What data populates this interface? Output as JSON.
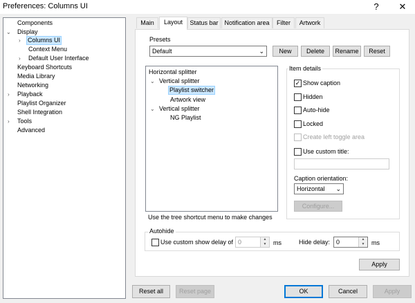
{
  "window": {
    "title": "Preferences: Columns UI",
    "help_glyph": "?",
    "close_glyph": "✕"
  },
  "tree": {
    "items": [
      {
        "label": "Components"
      },
      {
        "label": "Display"
      },
      {
        "label": "Columns UI"
      },
      {
        "label": "Context Menu"
      },
      {
        "label": "Default User Interface"
      },
      {
        "label": "Keyboard Shortcuts"
      },
      {
        "label": "Media Library"
      },
      {
        "label": "Networking"
      },
      {
        "label": "Playback"
      },
      {
        "label": "Playlist Organizer"
      },
      {
        "label": "Shell Integration"
      },
      {
        "label": "Tools"
      },
      {
        "label": "Advanced"
      }
    ]
  },
  "tabs": [
    {
      "label": "Main"
    },
    {
      "label": "Layout"
    },
    {
      "label": "Status bar"
    },
    {
      "label": "Notification area"
    },
    {
      "label": "Filter"
    },
    {
      "label": "Artwork"
    }
  ],
  "presets": {
    "group_label": "Presets",
    "selected": "Default",
    "new_label": "New",
    "delete_label": "Delete",
    "rename_label": "Rename",
    "reset_label": "Reset"
  },
  "layout_tree": {
    "items": [
      {
        "label": "Horizontal splitter"
      },
      {
        "label": "Vertical splitter"
      },
      {
        "label": "Playlist switcher"
      },
      {
        "label": "Artwork view"
      },
      {
        "label": "Vertical splitter"
      },
      {
        "label": "NG Playlist"
      }
    ],
    "hint": "Use the tree shortcut menu to make changes"
  },
  "item_details": {
    "group_label": "Item details",
    "show_caption": "Show caption",
    "hidden": "Hidden",
    "auto_hide": "Auto-hide",
    "locked": "Locked",
    "create_left_toggle": "Create left toggle area",
    "use_custom_title": "Use custom title:",
    "caption_orientation_label": "Caption orientation:",
    "caption_orientation_value": "Horizontal",
    "configure_label": "Configure..."
  },
  "autohide": {
    "group_label": "Autohide",
    "use_custom_delay": "Use custom show delay of",
    "show_delay_value": "0",
    "ms1": "ms",
    "hide_delay_label": "Hide delay:",
    "hide_delay_value": "0",
    "ms2": "ms"
  },
  "panel_apply_label": "Apply",
  "footer": {
    "reset_all": "Reset all",
    "reset_page": "Reset page",
    "ok": "OK",
    "cancel": "Cancel",
    "apply": "Apply"
  },
  "colors": {
    "selection": "#cce8ff",
    "accent": "#0078d7"
  }
}
